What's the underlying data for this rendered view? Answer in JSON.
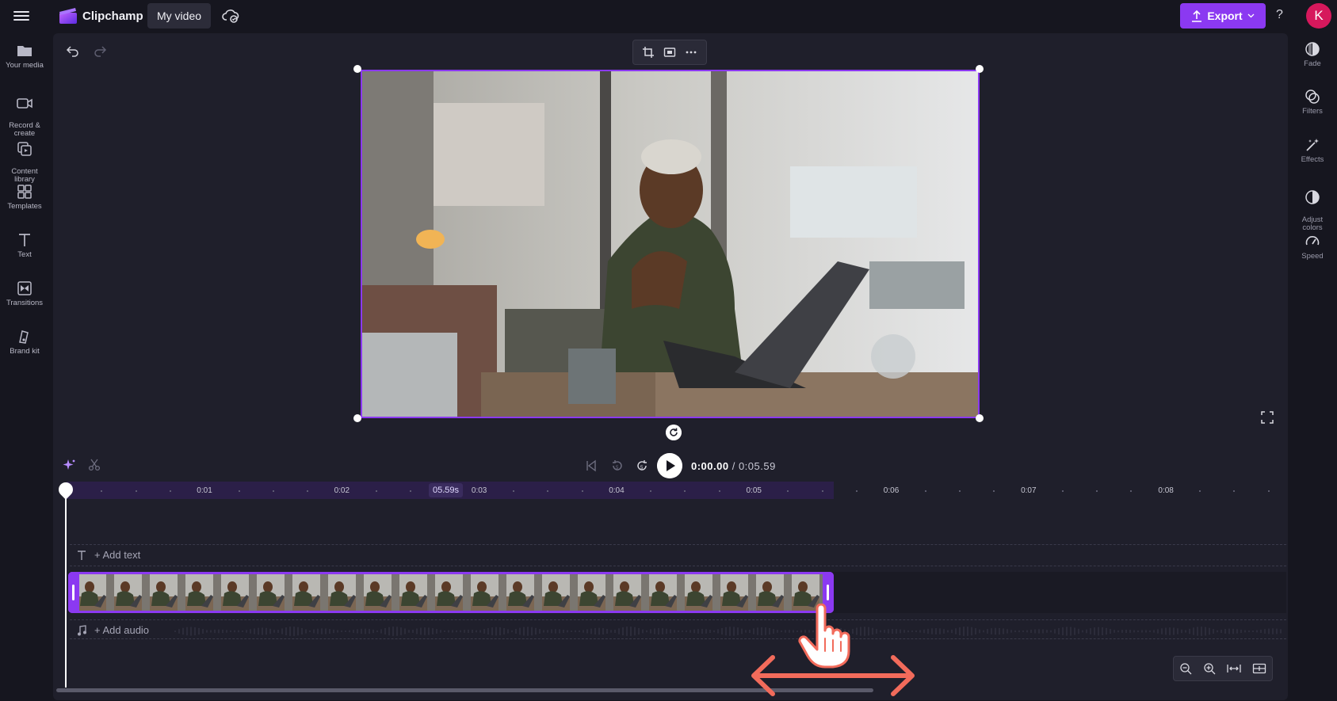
{
  "header": {
    "app_title": "Clipchamp",
    "project_name": "My video",
    "export_label": "Export",
    "help_label": "?",
    "avatar_initial": "K",
    "accent_color": "#8b39f1"
  },
  "left_sidebar": {
    "items": [
      {
        "label": "Your media",
        "icon": "folder-icon"
      },
      {
        "label": "Record &\ncreate",
        "icon": "camera-icon"
      },
      {
        "label": "Content\nlibrary",
        "icon": "library-icon"
      },
      {
        "label": "Templates",
        "icon": "templates-icon"
      },
      {
        "label": "Text",
        "icon": "text-icon"
      },
      {
        "label": "Transitions",
        "icon": "transitions-icon"
      },
      {
        "label": "Brand kit",
        "icon": "brand-kit-icon"
      }
    ]
  },
  "right_sidebar": {
    "items": [
      {
        "label": "Fade",
        "icon": "fade-icon"
      },
      {
        "label": "Filters",
        "icon": "filters-icon"
      },
      {
        "label": "Effects",
        "icon": "effects-icon"
      },
      {
        "label": "Adjust\ncolors",
        "icon": "adjust-colors-icon"
      },
      {
        "label": "Speed",
        "icon": "speed-icon"
      }
    ]
  },
  "playback": {
    "current_time": "0:00.00",
    "total_time": "/ 0:05.59"
  },
  "timeline": {
    "ruler_ticks": [
      "0:01",
      "0:02",
      "0:03",
      "0:04",
      "0:05",
      "0:06",
      "0:07",
      "0:08"
    ],
    "clip_end_marker": "05.59s",
    "add_text_label": "+ Add text",
    "add_audio_label": "+ Add audio"
  }
}
